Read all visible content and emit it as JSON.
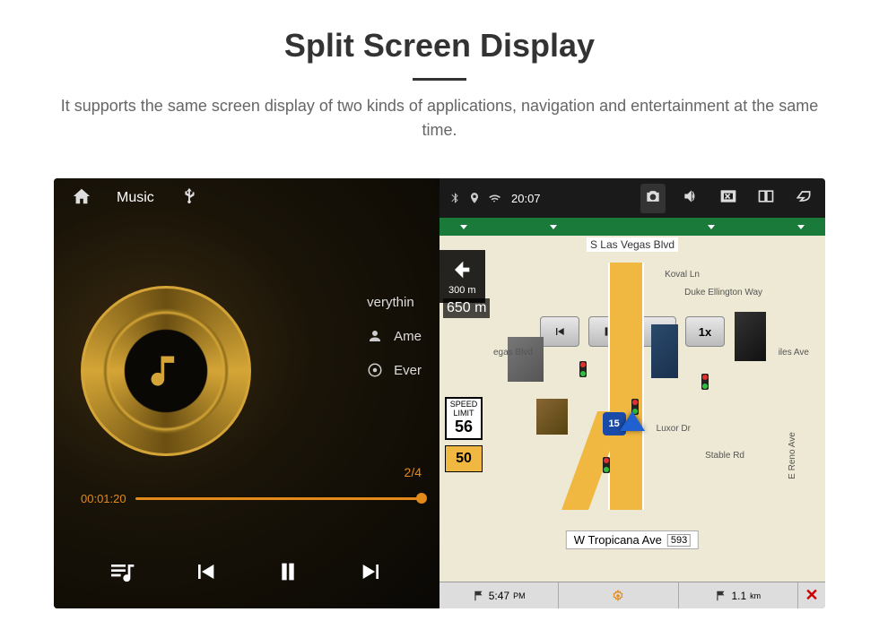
{
  "header": {
    "title": "Split Screen Display",
    "subtitle": "It supports the same screen display of two kinds of applications, navigation and entertainment at the same time."
  },
  "music": {
    "topbar": {
      "title": "Music",
      "usb": "usb-icon"
    },
    "tracks": {
      "now_playing": "verythin",
      "artist": "Ame",
      "album": "Ever"
    },
    "counter": "2/4",
    "time_current": "00:01:20",
    "controls": {
      "playlist": "playlist-icon",
      "prev": "prev-icon",
      "pause": "pause-icon",
      "next": "next-icon"
    }
  },
  "nav": {
    "status_time": "20:07",
    "streets": {
      "top": "S Las Vegas Blvd",
      "koval": "Koval Ln",
      "duke": "Duke Ellington Way",
      "luxor": "Luxor Dr",
      "stable": "Stable Rd",
      "reno": "E Reno Ave",
      "tropicana": "W Tropicana Ave",
      "tropicana_num": "593",
      "vegas_blvd": "egas Blvd",
      "iles": "iles Ave"
    },
    "turn": {
      "dist1": "300 m",
      "dist2": "650 m"
    },
    "media_speed": "1x",
    "speed_limit_label": "SPEED LIMIT",
    "speed_limit": "56",
    "current_speed": "50",
    "interstate": "15",
    "bottom": {
      "eta": "5:47",
      "unit1": "PM",
      "dist": "1.1",
      "unit2": "km"
    }
  }
}
